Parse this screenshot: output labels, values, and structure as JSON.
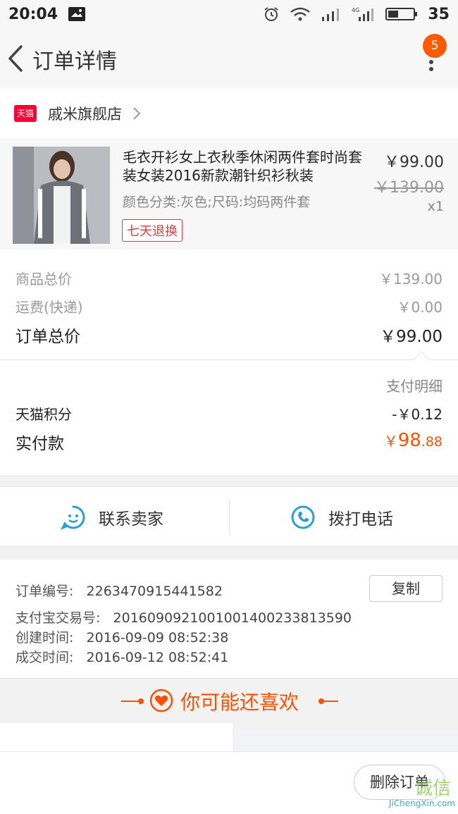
{
  "status": {
    "time": "20:04",
    "battery": "35"
  },
  "nav": {
    "title": "订单详情",
    "badge": "5"
  },
  "shop": {
    "logo": "天猫",
    "name": "戚米旗舰店"
  },
  "product": {
    "title": "毛衣开衫女上衣秋季休闲两件套时尚套装女装2016新款潮针织衫秋装",
    "spec": "颜色分类:灰色;尺码:均码两件套",
    "tag": "七天退换",
    "price": "￥99.00",
    "old_price": "￥139.00",
    "qty": "x1"
  },
  "summary": {
    "goods_label": "商品总价",
    "goods_value": "￥139.00",
    "ship_label": "运费(快递)",
    "ship_value": "￥0.00",
    "total_label": "订单总价",
    "total_value": "￥99.00",
    "pay_detail": "支付明细",
    "points_label": "天猫积分",
    "points_value": "-￥0.12",
    "paid_label": "实付款",
    "paid_currency": "￥",
    "paid_big": "98",
    "paid_small": ".88"
  },
  "actions": {
    "contact": "联系卖家",
    "call": "拨打电话"
  },
  "info": {
    "order_no_label": "订单编号:",
    "order_no": "2263470915441582",
    "copy": "复制",
    "alipay_label": "支付宝交易号:",
    "alipay_no": "2016090921001001400233813590",
    "created_label": "创建时间:",
    "created": "2016-09-09 08:52:38",
    "deal_label": "成交时间:",
    "deal": "2016-09-12 08:52:41"
  },
  "like": {
    "title": "你可能还喜欢"
  },
  "bottom": {
    "delete": "删除订单"
  },
  "watermark": {
    "text": "JiChengXin.com",
    "logo": "诚信"
  },
  "colors": {
    "accent": "#ff5000",
    "link_blue": "#2a9fd6",
    "tmall_red": "#ff0036"
  }
}
